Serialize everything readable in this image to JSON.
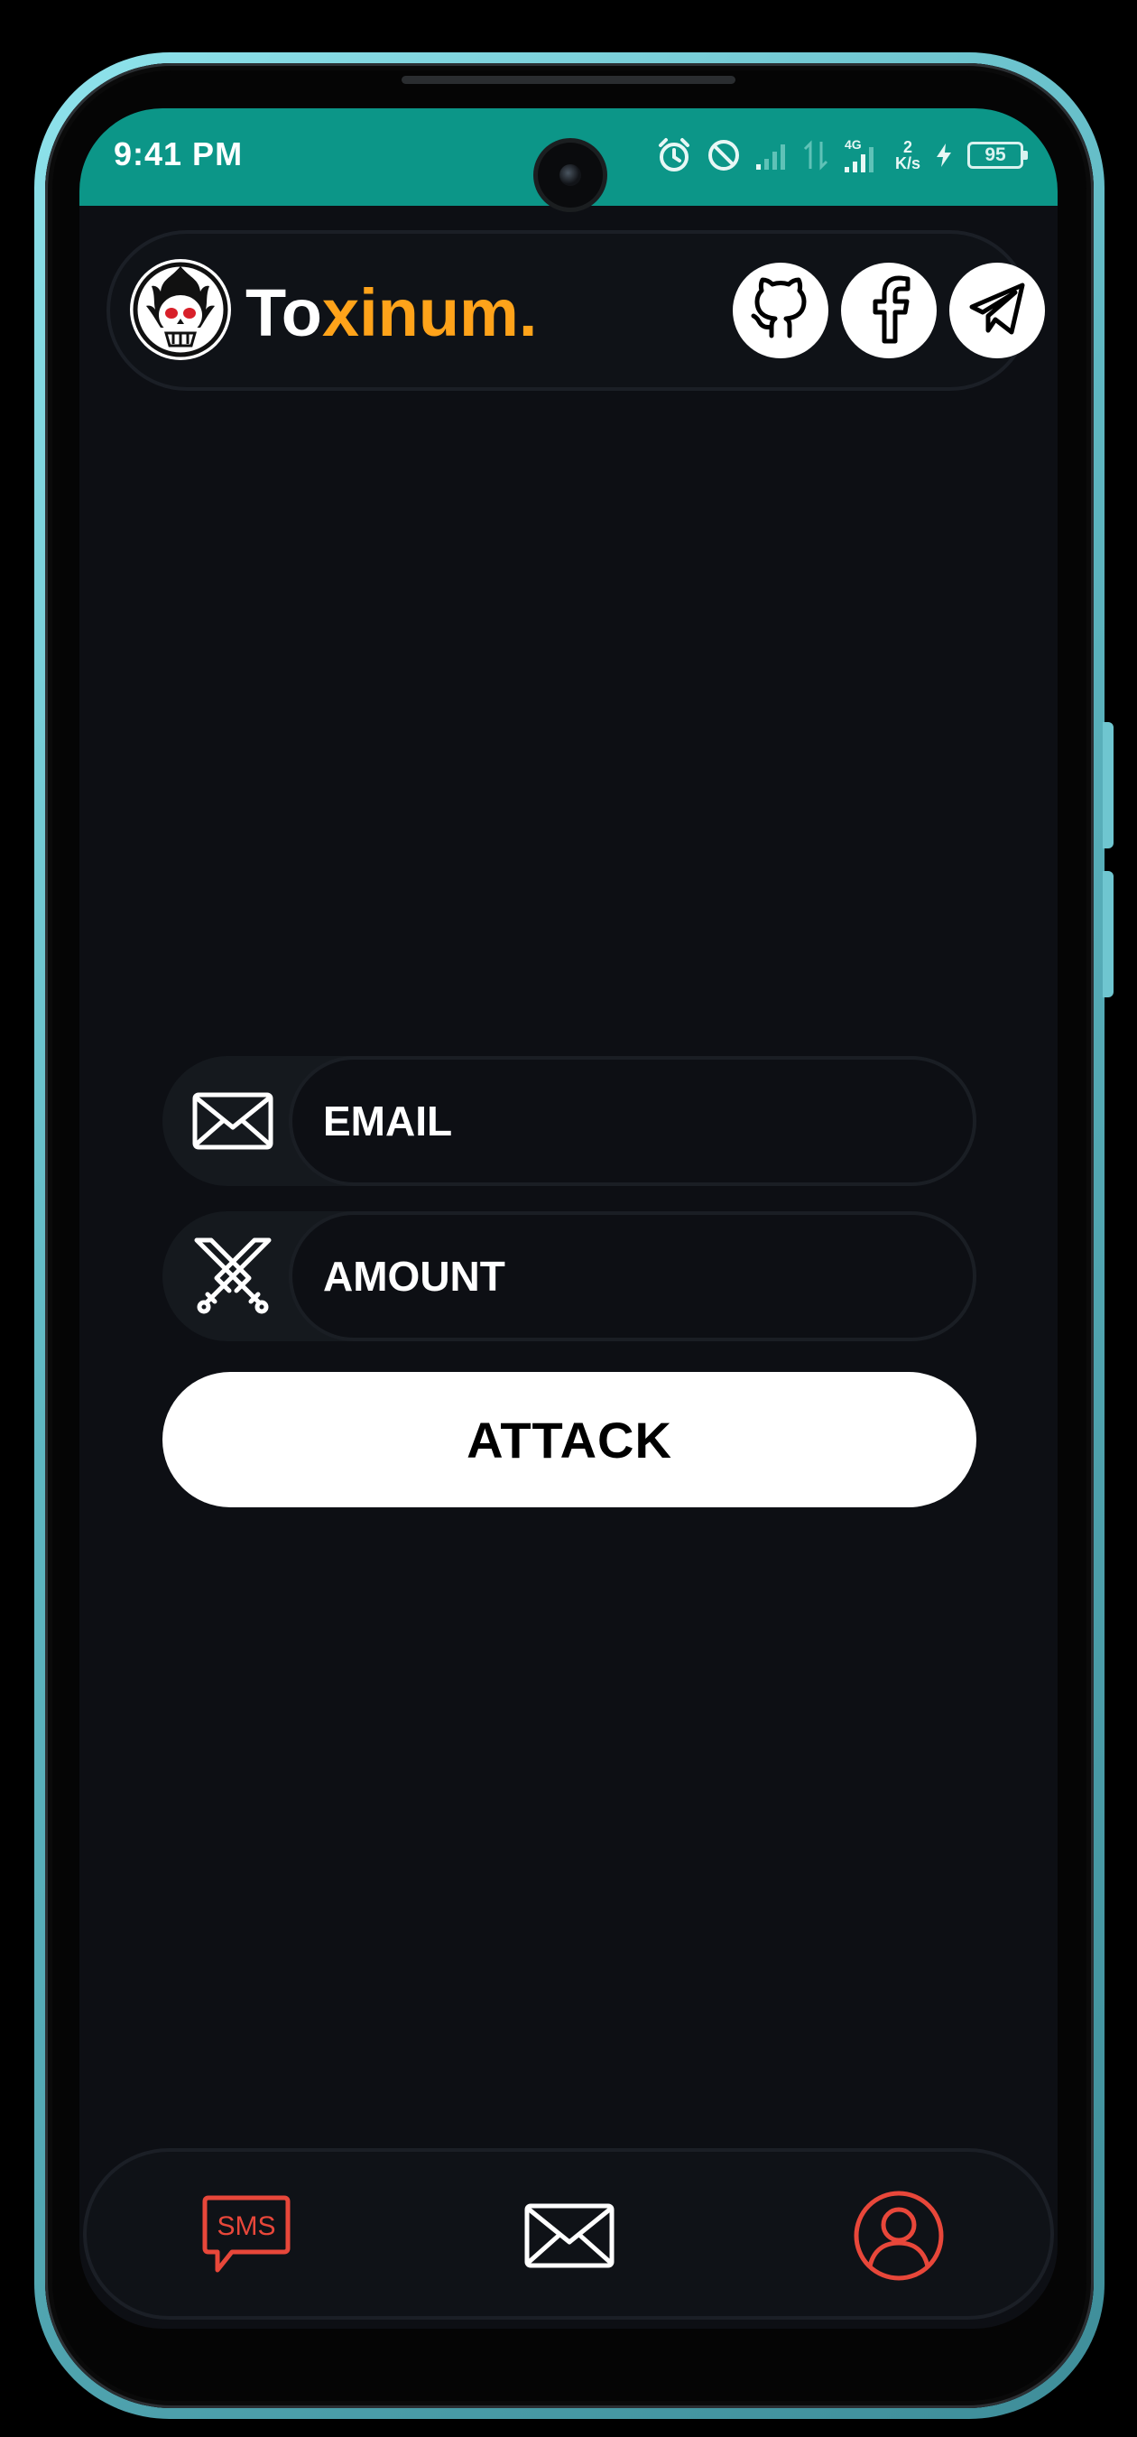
{
  "status_bar": {
    "time": "9:41 PM",
    "network_type": "4G",
    "speed_value": "2",
    "speed_unit": "K/s",
    "battery_level": "95",
    "background_color": "#0c9688",
    "icons": [
      "alarm-icon",
      "do-not-disturb-icon",
      "signal-icon",
      "data-transfer-icon",
      "signal-4g-icon",
      "charging-icon",
      "battery-icon"
    ]
  },
  "header": {
    "title_part1": "To",
    "title_part2": "xinum.",
    "title_colors": {
      "part1": "#ffffff",
      "part2": "#ffa31a"
    },
    "logo_icon": "skull-flame-logo",
    "social_links": [
      {
        "name": "github",
        "icon": "github-icon"
      },
      {
        "name": "facebook",
        "icon": "facebook-icon"
      },
      {
        "name": "telegram",
        "icon": "telegram-icon"
      }
    ]
  },
  "form": {
    "email": {
      "placeholder": "EMAIL",
      "value": "",
      "icon": "envelope-icon"
    },
    "amount": {
      "placeholder": "AMOUNT",
      "value": "",
      "icon": "crossed-swords-icon"
    },
    "submit_label": "ATTACK"
  },
  "bottom_nav": {
    "items": [
      {
        "name": "sms",
        "icon": "sms-icon",
        "icon_text": "SMS",
        "color": "#e8473a"
      },
      {
        "name": "mail",
        "icon": "envelope-icon",
        "color": "#ffffff"
      },
      {
        "name": "profile",
        "icon": "user-profile-icon",
        "color": "#e8473a"
      }
    ]
  },
  "theme": {
    "background": "#0d0f14",
    "accent": "#ffa31a",
    "nav_accent": "#e8473a"
  }
}
